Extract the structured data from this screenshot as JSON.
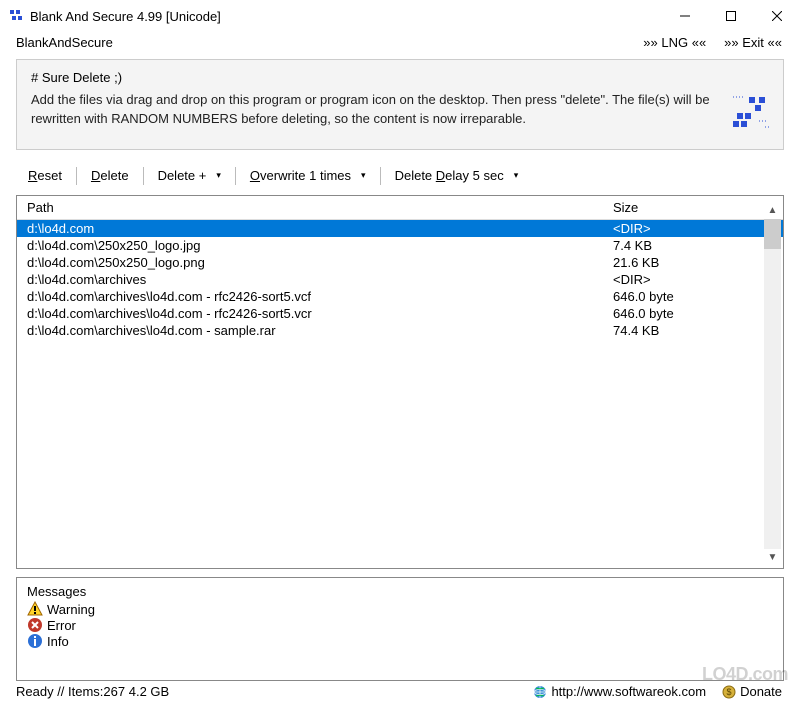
{
  "window": {
    "title": "Blank And Secure 4.99 [Unicode]"
  },
  "menu": {
    "app": "BlankAndSecure",
    "lng": "»»  LNG  ««",
    "exit": "»»  Exit  ««"
  },
  "info": {
    "title": "# Sure Delete ;)",
    "text": "Add the files via drag and drop on this program or program icon on the desktop. Then press \"delete\". The file(s) will be rewritten with RANDOM NUMBERS before deleting, so the content is now irreparable."
  },
  "toolbar": {
    "reset": [
      "R",
      "eset"
    ],
    "delete": [
      "D",
      "elete"
    ],
    "deleteplus": "Delete +",
    "overwrite": [
      "O",
      "verwrite 1 times"
    ],
    "delay_pre": "Delete ",
    "delay_mid": [
      "D",
      "elay 5 sec"
    ]
  },
  "list": {
    "header": {
      "path": "Path",
      "size": "Size"
    },
    "rows": [
      {
        "path": "d:\\lo4d.com",
        "size": "<DIR>",
        "selected": true
      },
      {
        "path": "d:\\lo4d.com\\250x250_logo.jpg",
        "size": "7.4 KB"
      },
      {
        "path": "d:\\lo4d.com\\250x250_logo.png",
        "size": "21.6 KB"
      },
      {
        "path": "d:\\lo4d.com\\archives",
        "size": "<DIR>"
      },
      {
        "path": "d:\\lo4d.com\\archives\\lo4d.com - rfc2426-sort5.vcf",
        "size": "646.0 byte"
      },
      {
        "path": "d:\\lo4d.com\\archives\\lo4d.com - rfc2426-sort5.vcr",
        "size": "646.0 byte"
      },
      {
        "path": "d:\\lo4d.com\\archives\\lo4d.com - sample.rar",
        "size": "74.4 KB"
      }
    ]
  },
  "messages": {
    "title": "Messages",
    "warning": "Warning",
    "error": "Error",
    "info": "Info"
  },
  "status": {
    "left": "Ready // Items:267 4.2 GB",
    "url": "http://www.softwareok.com",
    "donate": "Donate"
  },
  "watermark": "LO4D.com"
}
